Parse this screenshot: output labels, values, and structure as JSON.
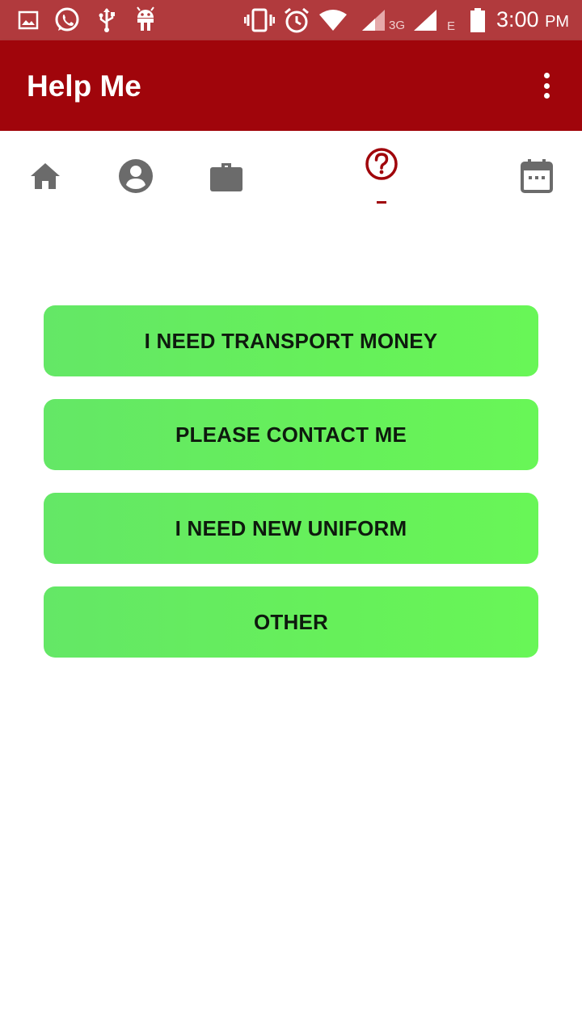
{
  "status_bar": {
    "network_3g": "3G",
    "network_e": "E",
    "time": "3:00",
    "ampm": "PM",
    "icons": [
      "gallery-icon",
      "whatsapp-icon",
      "usb-icon",
      "android-icon",
      "vibrate-icon",
      "alarm-icon",
      "wifi-icon",
      "signal-icon",
      "signal-icon",
      "battery-icon"
    ]
  },
  "app_bar": {
    "title": "Help Me",
    "overflow_icon": "more-vert-icon"
  },
  "tabs": [
    {
      "icon": "home-icon",
      "selected": false
    },
    {
      "icon": "account-icon",
      "selected": false
    },
    {
      "icon": "briefcase-icon",
      "selected": false
    },
    {
      "icon": "help-icon",
      "selected": true
    },
    {
      "icon": "calendar-icon",
      "selected": false
    }
  ],
  "options": [
    {
      "label": "I NEED TRANSPORT MONEY"
    },
    {
      "label": "PLEASE CONTACT ME"
    },
    {
      "label": "I NEED NEW UNIFORM"
    },
    {
      "label": "OTHER"
    }
  ],
  "colors": {
    "status_bar": "#b13a3d",
    "app_bar": "#a0050b",
    "accent": "#a0050b",
    "tab_icon": "#6b6b6b",
    "button_green": "#66f05a",
    "button_text": "#0e1a0e"
  }
}
